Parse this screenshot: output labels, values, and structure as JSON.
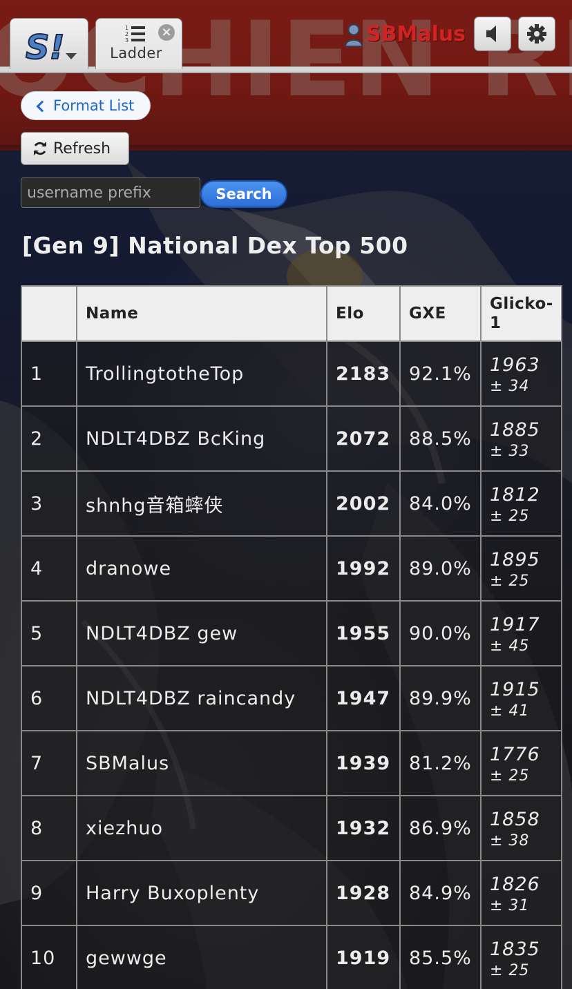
{
  "header": {
    "home_tab_logo": "S!",
    "ladder_tab_label": "Ladder",
    "username": "SBMalus",
    "banner_text": "OCHIEN REA"
  },
  "controls": {
    "format_list_label": "Format List",
    "refresh_label": "Refresh",
    "search_placeholder": "username prefix",
    "search_label": "Search"
  },
  "page_title": "[Gen 9] National Dex Top 500",
  "table": {
    "headers": [
      "",
      "Name",
      "Elo",
      "GXE",
      "Glicko-1"
    ],
    "rows": [
      {
        "rank": "1",
        "name": "TrollingtotheTop",
        "elo": "2183",
        "gxe": "92.1%",
        "glicko": "1963",
        "dev": "± 34"
      },
      {
        "rank": "2",
        "name": "NDLT4DBZ BcKing",
        "elo": "2072",
        "gxe": "88.5%",
        "glicko": "1885",
        "dev": "± 33"
      },
      {
        "rank": "3",
        "name": "shnhg音箱蟀侠",
        "elo": "2002",
        "gxe": "84.0%",
        "glicko": "1812",
        "dev": "± 25"
      },
      {
        "rank": "4",
        "name": "dranowe",
        "elo": "1992",
        "gxe": "89.0%",
        "glicko": "1895",
        "dev": "± 25"
      },
      {
        "rank": "5",
        "name": "NDLT4DBZ gew",
        "elo": "1955",
        "gxe": "90.0%",
        "glicko": "1917",
        "dev": "± 45"
      },
      {
        "rank": "6",
        "name": "NDLT4DBZ raincandy",
        "elo": "1947",
        "gxe": "89.9%",
        "glicko": "1915",
        "dev": "± 41"
      },
      {
        "rank": "7",
        "name": "SBMalus",
        "elo": "1939",
        "gxe": "81.2%",
        "glicko": "1776",
        "dev": "± 25"
      },
      {
        "rank": "8",
        "name": "xiezhuo",
        "elo": "1932",
        "gxe": "86.9%",
        "glicko": "1858",
        "dev": "± 38"
      },
      {
        "rank": "9",
        "name": "Harry Buxoplenty",
        "elo": "1928",
        "gxe": "84.9%",
        "glicko": "1826",
        "dev": "± 31"
      },
      {
        "rank": "10",
        "name": "gewwge",
        "elo": "1919",
        "gxe": "85.5%",
        "glicko": "1835",
        "dev": "± 25"
      }
    ]
  },
  "icons": {
    "back": "chevron-left-icon",
    "refresh": "refresh-icon",
    "sound": "speaker-icon",
    "settings": "gear-icon",
    "user": "user-icon",
    "close": "close-icon",
    "ladder": "numbered-list-icon"
  },
  "colors": {
    "banner_red": "#a3251b",
    "username_red": "#d32222",
    "link_blue": "#2166c8",
    "search_blue": "#2b6fd8"
  }
}
